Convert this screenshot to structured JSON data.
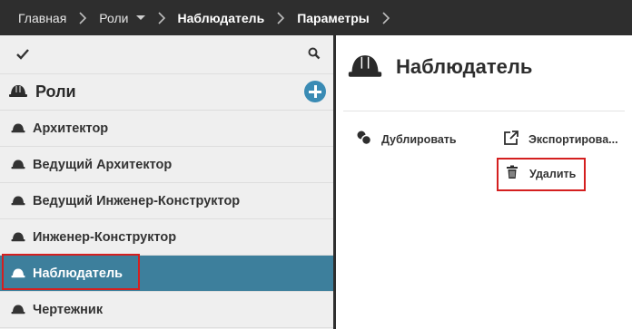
{
  "breadcrumb": {
    "home": "Главная",
    "roles": "Роли",
    "current": "Наблюдатель",
    "params": "Параметры"
  },
  "roles_panel": {
    "title": "Роли",
    "items": [
      {
        "label": "Архитектор"
      },
      {
        "label": "Ведущий Архитектор"
      },
      {
        "label": "Ведущий Инженер-Конструктор"
      },
      {
        "label": "Инженер-Конструктор"
      },
      {
        "label": "Наблюдатель",
        "selected": true
      },
      {
        "label": "Чертежник"
      }
    ]
  },
  "details": {
    "title": "Наблюдатель",
    "actions": {
      "duplicate": "Дублировать",
      "export": "Экспортирова...",
      "delete": "Удалить"
    }
  },
  "colors": {
    "topbar": "#2e2e2e",
    "selected_row": "#3d7f9c",
    "accent": "#3a8bb4",
    "highlight": "#d41f1f"
  },
  "icons": {
    "role": "hard-hat-icon",
    "add": "plus-circle-icon",
    "check": "check-icon",
    "search": "search-icon",
    "duplicate": "duplicate-icon",
    "export": "export-icon",
    "delete": "trash-icon"
  }
}
